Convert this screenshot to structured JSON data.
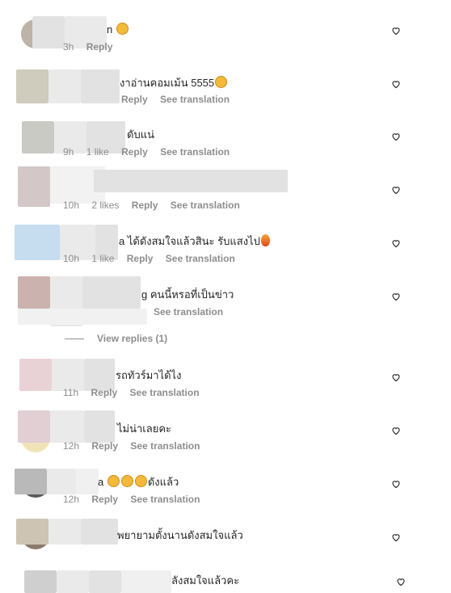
{
  "comments": [
    {
      "text": "n",
      "emoji": "clap",
      "meta": {
        "time": "3h",
        "likes": "",
        "reply": "Reply",
        "translate": ""
      }
    },
    {
      "text": "งาอ่านคอมเม้น 5555",
      "emoji": "clap",
      "meta": {
        "time": "",
        "likes": "",
        "reply": "Reply",
        "translate": "See translation"
      }
    },
    {
      "text": "ดับแน่",
      "emoji": "",
      "meta": {
        "time": "9h",
        "likes": "1 like",
        "reply": "Reply",
        "translate": "See translation"
      }
    },
    {
      "text": "",
      "emoji": "",
      "meta": {
        "time": "10h",
        "likes": "2 likes",
        "reply": "Reply",
        "translate": "See translation"
      }
    },
    {
      "text": "a ได้ดังสมใจแล้วสินะ รับแสงไป",
      "emoji": "fire",
      "meta": {
        "time": "10h",
        "likes": "1 like",
        "reply": "Reply",
        "translate": "See translation"
      }
    },
    {
      "text": "g คนนี้หรอที่เป็นข่าว",
      "emoji": "",
      "meta": {
        "time": "",
        "likes": "",
        "reply": "",
        "translate": "See translation"
      }
    },
    {
      "text": "รถทัวร์มาได้ไง",
      "emoji": "",
      "meta": {
        "time": "11h",
        "likes": "",
        "reply": "Reply",
        "translate": "See translation"
      }
    },
    {
      "text": "ไม่น่าเลยคะ",
      "emoji": "",
      "meta": {
        "time": "12h",
        "likes": "",
        "reply": "Reply",
        "translate": "See translation"
      }
    },
    {
      "text": "a",
      "emoji": "clap3",
      "text_after": "ดังแล้ว",
      "meta": {
        "time": "12h",
        "likes": "",
        "reply": "Reply",
        "translate": "See translation"
      }
    },
    {
      "text": "พยายามตั้งนานดังสมใจแล้ว",
      "emoji": "",
      "meta": {
        "time": "",
        "likes": "",
        "reply": "",
        "translate": ""
      }
    },
    {
      "text": "ลังสมใจแล้วคะ",
      "emoji": "",
      "meta": {
        "time": "",
        "likes": "",
        "reply": "",
        "translate": ""
      }
    }
  ],
  "view_replies": "View replies (1)",
  "icons": {
    "like": "heart-outline-icon"
  }
}
